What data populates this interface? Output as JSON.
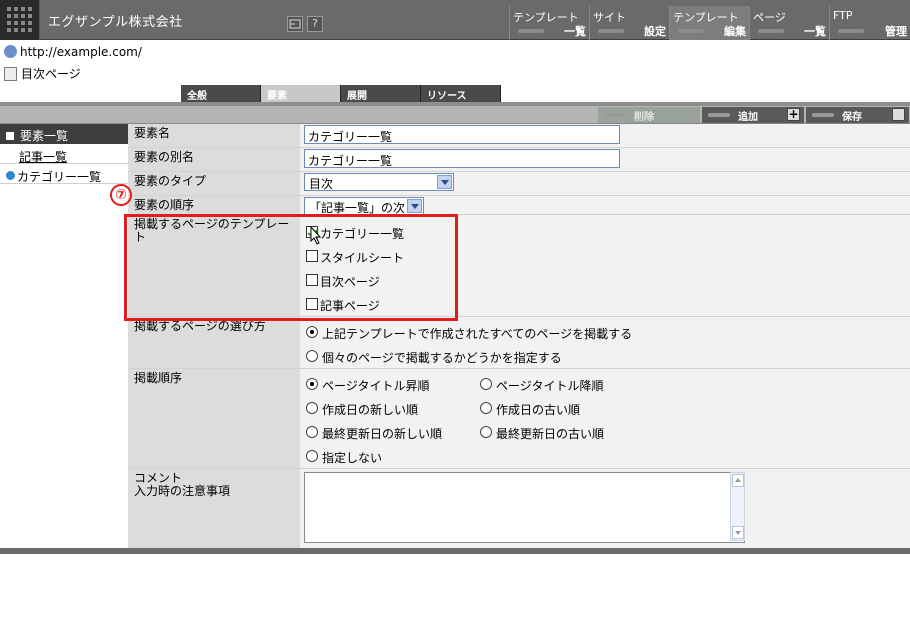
{
  "header": {
    "title": "エグザンプル株式会社",
    "icons": [
      "window-icon",
      "help-icon"
    ],
    "help_glyph": "?",
    "menus": [
      {
        "top": "テンプレート",
        "bottom": "一覧"
      },
      {
        "top": "サイト",
        "bottom": "設定"
      },
      {
        "top": "テンプレート",
        "bottom": "編集"
      },
      {
        "top": "ページ",
        "bottom": "一覧"
      },
      {
        "top": "FTP",
        "bottom": "管理"
      }
    ]
  },
  "site": {
    "url": "http://example.com/",
    "page": "目次ページ"
  },
  "tabs": [
    "全般",
    "要素",
    "展開",
    "リソース"
  ],
  "actions": {
    "delete": "削除",
    "add": "追加",
    "add_glyph": "+",
    "save": "保存"
  },
  "sidebar": {
    "header": "要素一覧",
    "items": [
      "記事一覧",
      "カテゴリー一覧"
    ]
  },
  "form": {
    "element_name": {
      "label": "要素名",
      "value": "カテゴリー一覧"
    },
    "element_alias": {
      "label": "要素の別名",
      "value": "カテゴリー一覧"
    },
    "element_type": {
      "label": "要素のタイプ",
      "value": "目次"
    },
    "element_order": {
      "label": "要素の順序",
      "value": "「記事一覧」の次"
    },
    "templates": {
      "label": "掲載するページのテンプレート",
      "options": [
        {
          "label": "カテゴリー一覧",
          "checked": true
        },
        {
          "label": "スタイルシート",
          "checked": false
        },
        {
          "label": "目次ページ",
          "checked": false
        },
        {
          "label": "記事ページ",
          "checked": false
        }
      ]
    },
    "selection": {
      "label": "掲載するページの選び方",
      "options": [
        {
          "label": "上記テンプレートで作成されたすべてのページを掲載する",
          "selected": true
        },
        {
          "label": "個々のページで掲載するかどうかを指定する",
          "selected": false
        }
      ]
    },
    "sort": {
      "label": "掲載順序",
      "options": [
        {
          "label": "ページタイトル昇順",
          "selected": true
        },
        {
          "label": "ページタイトル降順",
          "selected": false
        },
        {
          "label": "作成日の新しい順",
          "selected": false
        },
        {
          "label": "作成日の古い順",
          "selected": false
        },
        {
          "label": "最終更新日の新しい順",
          "selected": false
        },
        {
          "label": "最終更新日の古い順",
          "selected": false
        },
        {
          "label": "指定しない",
          "selected": false
        }
      ]
    },
    "comment": {
      "label_line1": "コメント",
      "label_line2": "入力時の注意事項",
      "value": ""
    }
  },
  "annotation": {
    "number": "⑦",
    "color": "#e21b1b"
  }
}
